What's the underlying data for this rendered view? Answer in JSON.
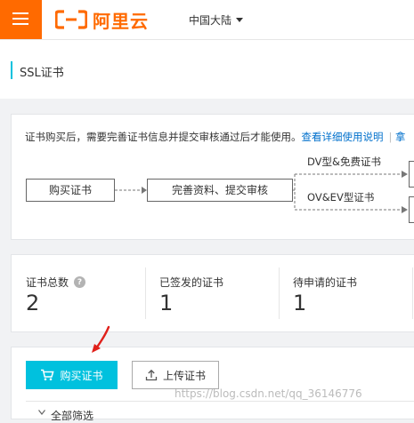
{
  "header": {
    "logo_text": "阿里云",
    "region": "中国大陆",
    "brand_color": "#ff6a00"
  },
  "page": {
    "title": "SSL证书",
    "accent_color": "#00c1de"
  },
  "notice": {
    "text": "证书购买后，需要完善证书信息并提交审核通过后才能使用。",
    "link": "查看详细使用说明",
    "more": "拿"
  },
  "flow": {
    "step1": "购买证书",
    "step2": "完善资料、提交审核",
    "branch1": "DV型&免费证书",
    "branch2": "OV&EV型证书"
  },
  "stats": [
    {
      "label": "证书总数",
      "value": "2",
      "help": "?"
    },
    {
      "label": "已签发的证书",
      "value": "1"
    },
    {
      "label": "待申请的证书",
      "value": "1"
    }
  ],
  "actions": {
    "buy": "购买证书",
    "upload": "上传证书"
  },
  "filter": {
    "label": "全部筛选"
  },
  "watermark": "https://blog.csdn.net/qq_36146776"
}
